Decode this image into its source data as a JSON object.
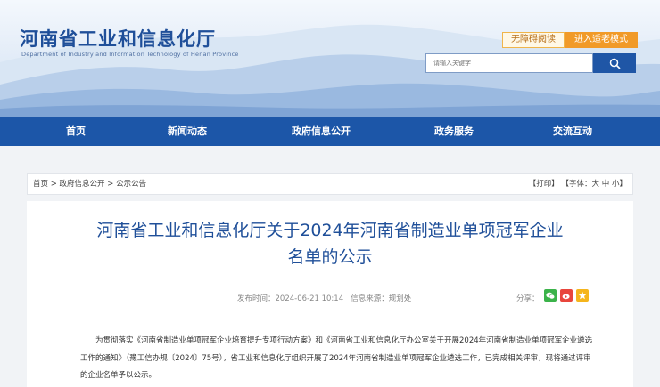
{
  "header": {
    "site_title": "河南省工业和信息化厅",
    "site_subtitle": "Department of Industry and Information Technology of Henan Province",
    "accessibility_label": "无障碍阅读",
    "elder_mode_label": "进入适老模式",
    "search_placeholder": "请输入关键字",
    "search_icon": "magnifier-icon"
  },
  "nav": {
    "items": [
      {
        "label": "首页"
      },
      {
        "label": "新闻动态"
      },
      {
        "label": "政府信息公开"
      },
      {
        "label": "政务服务"
      },
      {
        "label": "交流互动"
      }
    ]
  },
  "breadcrumb": {
    "items": [
      "首页",
      "政府信息公开",
      "公示公告"
    ],
    "separator": ">"
  },
  "tools": {
    "print_label": "【打印】",
    "font_label": "【字体：",
    "font_large": "大",
    "font_medium": "中",
    "font_small": "小",
    "font_close": "】"
  },
  "article": {
    "title_line1": "河南省工业和信息化厅关于2024年河南省制造业单项冠军企业",
    "title_line2": "名单的公示",
    "publish_time": "发布时间：2024-06-21 10:14",
    "source": "信息来源：规划处",
    "share_label": "分享：",
    "share_icons": [
      "wechat-icon",
      "weibo-icon",
      "qzone-icon"
    ],
    "body": "为贯彻落实《河南省制造业单项冠军企业培育提升专项行动方案》和《河南省工业和信息化厅办公室关于开展2024年河南省制造业单项冠军企业遴选工作的通知》（豫工信办规〔2024〕75号），省工业和信息化厅组织开展了2024年河南省制造业单项冠军企业遴选工作，已完成相关评审，现将通过评审的企业名单予以公示。"
  },
  "colors": {
    "brand_blue": "#1c56a8",
    "title_blue": "#1f4f99",
    "accent_orange": "#f19a28"
  }
}
